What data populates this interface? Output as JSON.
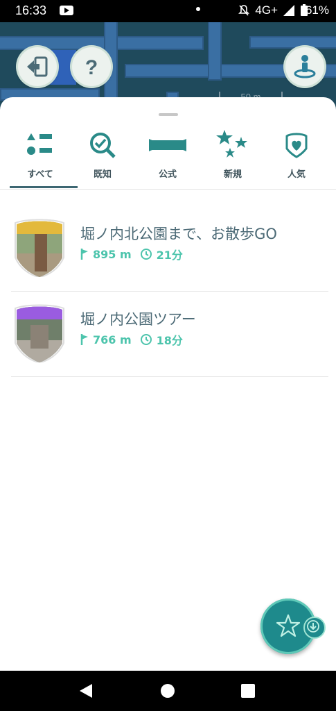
{
  "status_bar": {
    "time": "16:33",
    "network": "4G+",
    "battery": "61%"
  },
  "map": {
    "scale_label": "50 m",
    "exit_button_icon": "exit-icon",
    "help_button_icon": "question-icon",
    "player_button_icon": "player-location-icon"
  },
  "tabs": [
    {
      "label": "すべて",
      "icon": "all-list-icon",
      "active": true
    },
    {
      "label": "既知",
      "icon": "search-check-icon",
      "active": false
    },
    {
      "label": "公式",
      "icon": "official-banner-icon",
      "active": false
    },
    {
      "label": "新規",
      "icon": "new-stars-icon",
      "active": false
    },
    {
      "label": "人気",
      "icon": "popular-heart-icon",
      "active": false
    }
  ],
  "routes": [
    {
      "title": "堀ノ内北公園まで、お散歩GO",
      "distance": "895 m",
      "duration": "21分",
      "badge_color": "#e3b93c"
    },
    {
      "title": "堀ノ内公園ツアー",
      "distance": "766 m",
      "duration": "18分",
      "badge_color": "#9a5ce0"
    }
  ],
  "colors": {
    "accent": "#1e8a8c",
    "meta_green": "#4cc4ac",
    "title_text": "#4c6a76"
  },
  "fab": {
    "icon": "star-icon",
    "badge_icon": "download-arrow-icon"
  }
}
